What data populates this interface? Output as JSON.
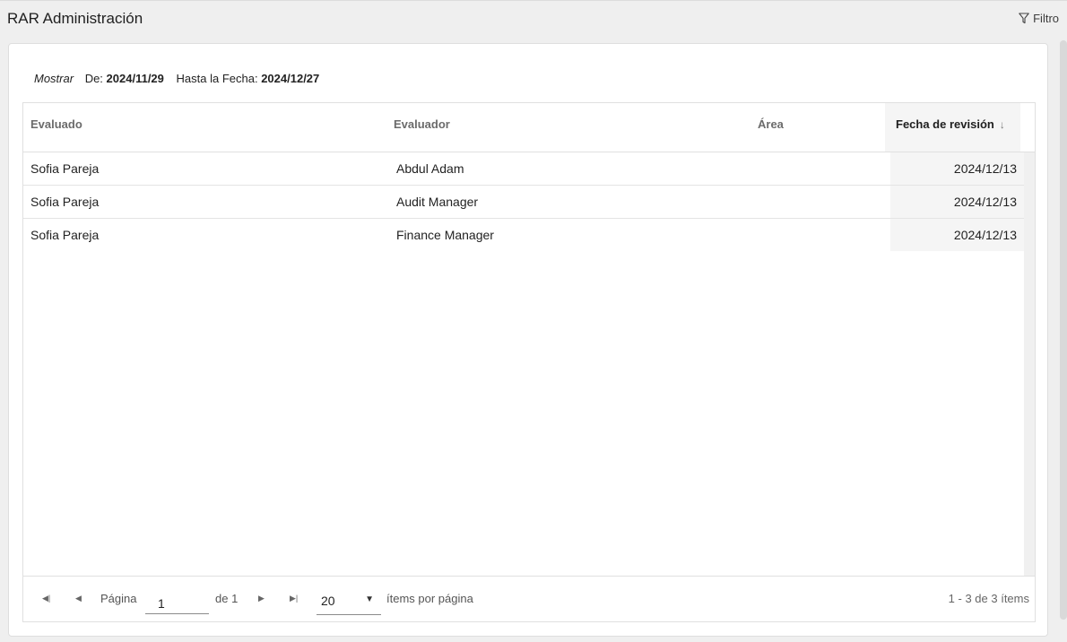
{
  "header": {
    "title": "RAR Administración",
    "filter_label": "Filtro"
  },
  "date_filter": {
    "mostrar_label": "Mostrar",
    "from_label": "De:",
    "from_value": "2024/11/29",
    "to_label": "Hasta la Fecha:",
    "to_value": "2024/12/27"
  },
  "grid": {
    "columns": [
      {
        "label": "Evaluado"
      },
      {
        "label": "Evaluador"
      },
      {
        "label": "Área"
      },
      {
        "label": "Fecha de revisión",
        "sort": "↓"
      }
    ],
    "rows": [
      {
        "evaluado": "Sofia Pareja",
        "evaluador": "Abdul Adam",
        "area": "",
        "fecha": "2024/12/13"
      },
      {
        "evaluado": "Sofia Pareja",
        "evaluador": "Audit Manager",
        "area": "",
        "fecha": "2024/12/13"
      },
      {
        "evaluado": "Sofia Pareja",
        "evaluador": "Finance Manager",
        "area": "",
        "fecha": "2024/12/13"
      }
    ]
  },
  "pager": {
    "first_icon": "first-page-icon",
    "prev_icon": "previous-page-icon",
    "next_icon": "next-page-icon",
    "last_icon": "last-page-icon",
    "page_label": "Página",
    "page_value": "1",
    "of_label": "de 1",
    "page_size": "20",
    "items_per_page_label": "ítems por página",
    "summary": "1 - 3 de 3 ítems"
  }
}
